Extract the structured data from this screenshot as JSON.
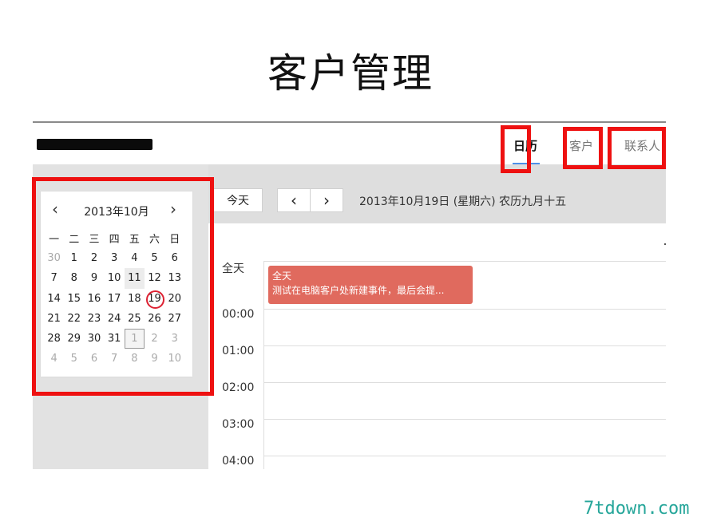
{
  "slide": {
    "title": "客户管理"
  },
  "nav": {
    "tabs": [
      "日历",
      "客户",
      "联系人"
    ]
  },
  "toolbar": {
    "today": "今天",
    "prev": "‹",
    "next": "›",
    "date": "2013年10月19日 (星期六) 农历九月十五"
  },
  "mini_calendar": {
    "prev": "‹",
    "next": "›",
    "title": "2013年10月",
    "weekdays": [
      "一",
      "二",
      "三",
      "四",
      "五",
      "六",
      "日"
    ],
    "days": [
      [
        "30",
        "1",
        "2",
        "3",
        "4",
        "5",
        "6"
      ],
      [
        "7",
        "8",
        "9",
        "10",
        "11",
        "12",
        "13"
      ],
      [
        "14",
        "15",
        "16",
        "17",
        "18",
        "19",
        "20"
      ],
      [
        "21",
        "22",
        "23",
        "24",
        "25",
        "26",
        "27"
      ],
      [
        "28",
        "29",
        "30",
        "31",
        "1",
        "2",
        "3"
      ],
      [
        "4",
        "5",
        "6",
        "7",
        "8",
        "9",
        "10"
      ]
    ]
  },
  "day_view": {
    "all_day_label": "全天",
    "event": {
      "title": "全天",
      "text": "测试在电脑客户处新建事件，最后会提..."
    },
    "hours": [
      "00:00",
      "01:00",
      "02:00",
      "03:00",
      "04:00"
    ]
  },
  "colors": {
    "highlight": "#ee1111",
    "event": "#e06a5e",
    "accent": "#4d8fe8",
    "watermark": "#26a69a"
  },
  "watermark": "7tdown.com"
}
